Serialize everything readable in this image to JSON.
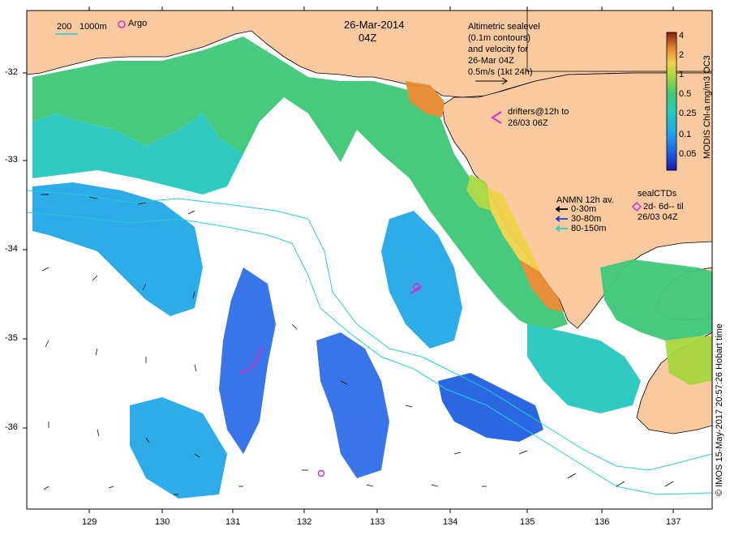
{
  "title": {
    "date": "26-Mar-2014",
    "time": "04Z"
  },
  "scale_bar": {
    "depth_200": "200",
    "depth_1000": "1000m"
  },
  "argo": {
    "label": "Argo",
    "color": "#d22fc8"
  },
  "altimetry_note": [
    "Altimetric sealevel",
    "(0.1m contours)",
    "and velocity for",
    "26-Mar 04Z",
    "0.5m/s (1kt 24h)"
  ],
  "drifters_note": [
    "drifters@12h to",
    "26/03 06Z"
  ],
  "anmn": {
    "title": "ANMN 12h av.",
    "items": [
      {
        "label": "0-30m",
        "color": "#000000"
      },
      {
        "label": "30-80m",
        "color": "#1f3cd8"
      },
      {
        "label": "80-150m",
        "color": "#22d0d0"
      }
    ]
  },
  "seal_ctd": {
    "title": "sealCTDs",
    "line1": "2d- 6d-- til",
    "line2": "26/03 04Z",
    "color": "#d22fc8"
  },
  "colorbar": {
    "label": "MODIS Chl-a mg/m3 OC3",
    "ticks": [
      "4",
      "2",
      "1",
      "0.5",
      "0.25",
      "0.1",
      "0.05"
    ]
  },
  "credit": "© IMOS 15-May-2017 20:57:26 Hobart time",
  "axes": {
    "lat_ticks": [
      "-32",
      "-33",
      "-34",
      "-35",
      "-36"
    ],
    "lon_ticks": [
      "129",
      "130",
      "131",
      "132",
      "133",
      "134",
      "135",
      "136",
      "137"
    ]
  },
  "colors": {
    "land": "#f9c9a0",
    "ocean": "#ffffff",
    "contour": "#22d0d0"
  }
}
